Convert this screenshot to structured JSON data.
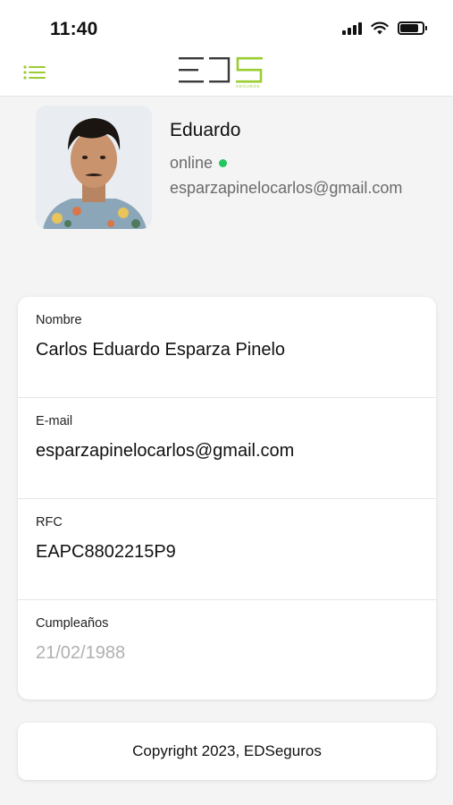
{
  "status_bar": {
    "time": "11:40",
    "icons": [
      "cellular-signal-icon",
      "wifi-icon",
      "battery-icon"
    ]
  },
  "header": {
    "menu_icon": "hamburger-menu-icon",
    "logo_text": "EDS",
    "logo_subtext": "SEGUROS",
    "accent_color": "#9acd32"
  },
  "profile": {
    "name": "Eduardo",
    "status": "online",
    "status_color": "#22c55e",
    "email": "esparzapinelocarlos@gmail.com"
  },
  "info": [
    {
      "label": "Nombre",
      "value": "Carlos Eduardo Esparza Pinelo"
    },
    {
      "label": "E-mail",
      "value": "esparzapinelocarlos@gmail.com"
    },
    {
      "label": "RFC",
      "value": "EAPC8802215P9"
    },
    {
      "label": "Cumpleaños",
      "value": "21/02/1988"
    }
  ],
  "footer": {
    "text": "Copyright 2023, EDSeguros"
  }
}
